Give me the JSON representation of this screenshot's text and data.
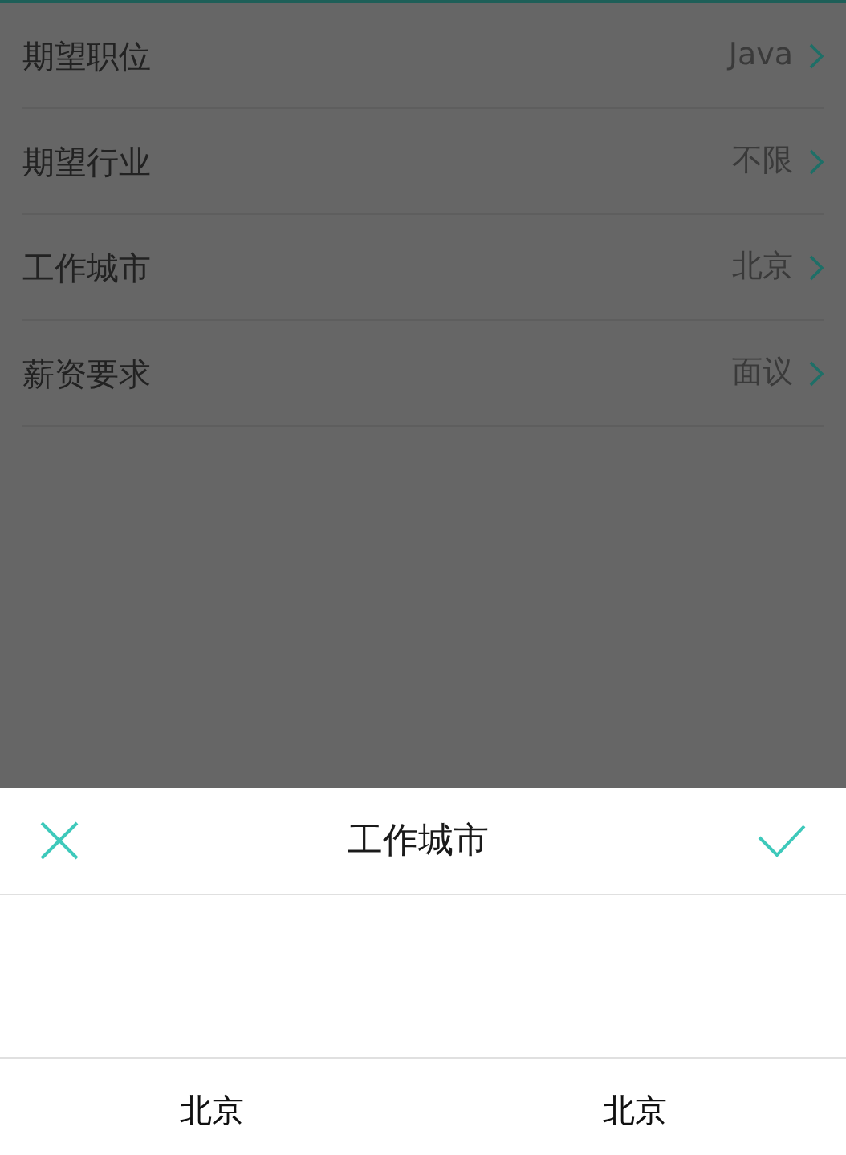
{
  "settings": [
    {
      "label": "期望职位",
      "value": "Java"
    },
    {
      "label": "期望行业",
      "value": "不限"
    },
    {
      "label": "工作城市",
      "value": "北京"
    },
    {
      "label": "薪资要求",
      "value": "面议"
    }
  ],
  "sheet": {
    "title": "工作城市",
    "columns": [
      {
        "value": "北京"
      },
      {
        "value": "北京"
      }
    ]
  }
}
